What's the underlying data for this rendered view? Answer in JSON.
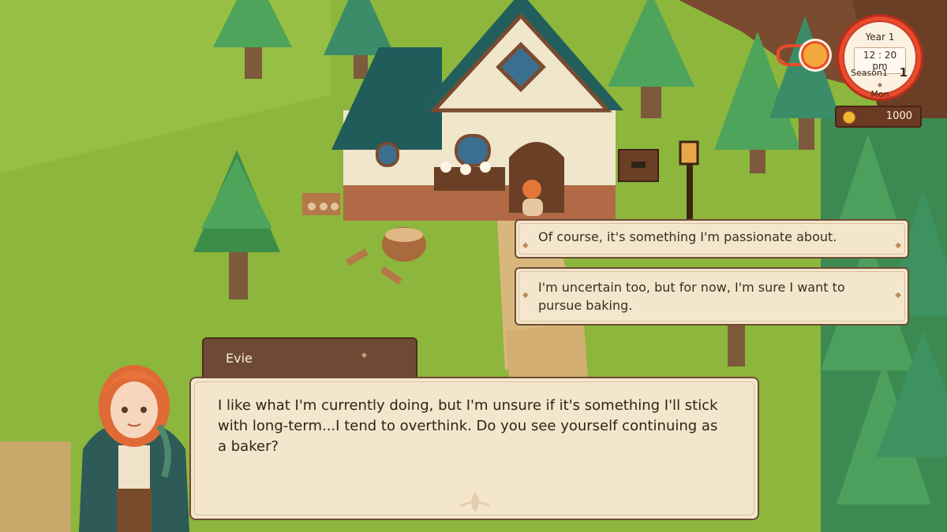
{
  "hud": {
    "year": "Year 1",
    "time": "12 : 20 pm",
    "season": "Season1",
    "season_num": "1",
    "day_mark": "◆",
    "day": "Mon",
    "money": "1000",
    "clock_color": "#e94b2c",
    "coin_icon": "gold-coin-icon"
  },
  "choices": [
    {
      "text": "Of course, it's something I'm passionate about."
    },
    {
      "text": "I'm uncertain too, but for now, I'm sure I want to pursue baking."
    }
  ],
  "dialogue": {
    "speaker": "Evie",
    "text": "I like what I'm currently doing, but I'm unsure if it's something I'll stick with long-term...I tend to overthink. Do you see yourself continuing as a baker?"
  },
  "colors": {
    "panel_bg": "#f4e6cc",
    "panel_border": "#6e4a34",
    "name_tab": "#6e4a34",
    "grass": "#8cb63c"
  }
}
